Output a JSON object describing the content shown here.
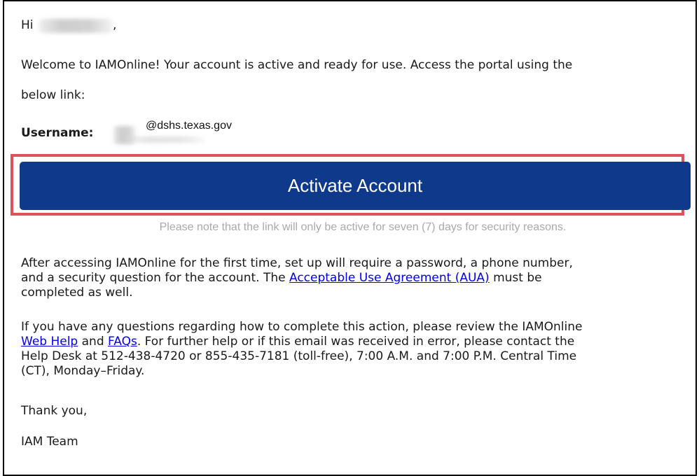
{
  "greeting": {
    "prefix": "Hi",
    "suffix": ","
  },
  "welcome": {
    "line1": "Welcome to IAMOnline! Your account is active and ready for use. Access the portal using the",
    "line2": "below link:"
  },
  "username": {
    "label": "Username:",
    "domain": "@dshs.texas.gov"
  },
  "activate_button": {
    "label": "Activate Account",
    "color": "#0f3a8c"
  },
  "highlight_color": "#e0525a",
  "note": "Please note that the link will only be active for seven (7) days for security reasons.",
  "setup": {
    "line1": "After accessing IAMOnline for the first time, set up will require a password, a phone number,",
    "line2_pre": "and a security question for the account. The ",
    "aua_link": "Acceptable Use Agreement (AUA)",
    "line2_post": " must be",
    "line3": "completed as well."
  },
  "help": {
    "line1": "If you have any questions regarding how to complete this action, please review the IAMOnline",
    "web_help_link": "Web Help",
    "and": " and ",
    "faqs_link": "FAQs",
    "line2_post": ". For further help or if this email was received in error, please contact the",
    "line3": "Help Desk at 512-438-4720 or 855-435-7181 (toll-free), 7:00 A.M. and 7:00 P.M. Central Time",
    "line4": "(CT), Monday–Friday."
  },
  "closing": {
    "thanks": "Thank you,",
    "signature": "IAM Team"
  }
}
